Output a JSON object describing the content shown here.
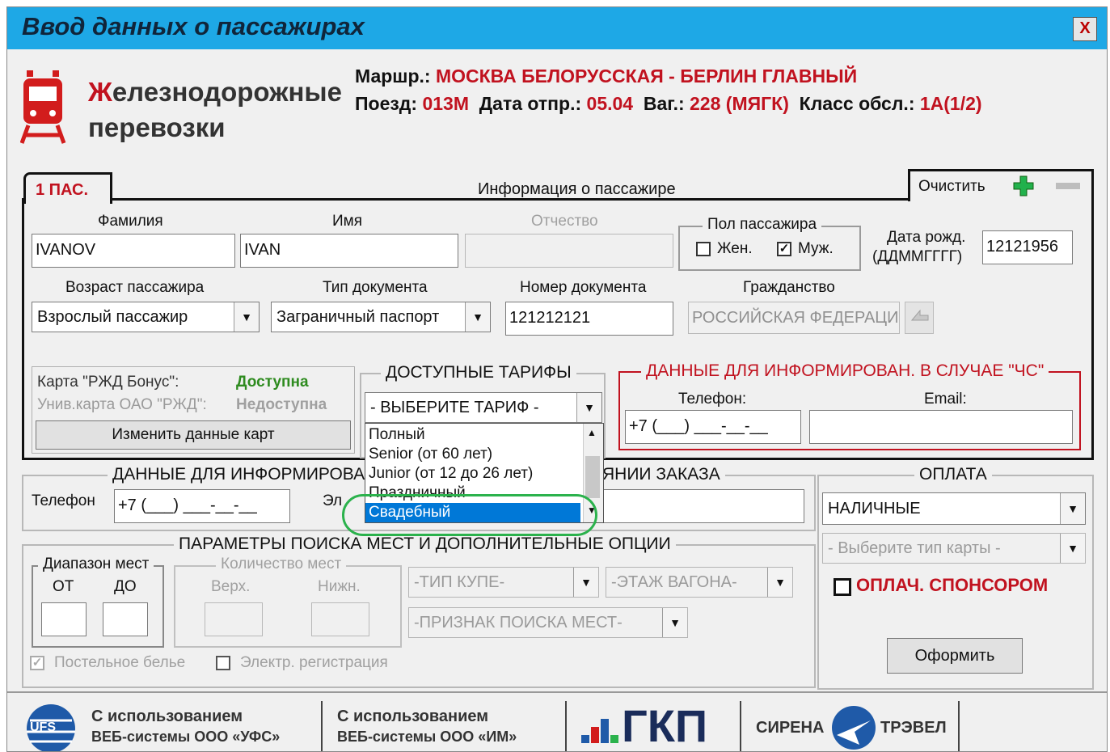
{
  "window": {
    "title": "Ввод данных о пассажирах",
    "close_glyph": "X"
  },
  "logo": {
    "line1_first": "Ж",
    "line1_rest": "елезнодорожные",
    "line2": "перевозки"
  },
  "route": {
    "label": "Маршр.:",
    "value": "МОСКВА БЕЛОРУССКАЯ - БЕРЛИН ГЛАВНЫЙ",
    "train_label": "Поезд:",
    "train_value": "013М",
    "date_label": "Дата отпр.:",
    "date_value": "05.04",
    "car_label": "Ваг.:",
    "car_value": "228 (МЯГК)",
    "class_label": "Класс обсл.:",
    "class_value": "1А(1/2)"
  },
  "passenger_panel": {
    "tab": "1 ПАС.",
    "header": "Информация о пассажире",
    "clear_button": "Очистить",
    "surname_label": "Фамилия",
    "surname_value": "IVANOV",
    "name_label": "Имя",
    "name_value": "IVAN",
    "patronymic_label": "Отчество",
    "patronymic_value": "",
    "gender_group": "Пол пассажира",
    "female_label": "Жен.",
    "male_label": "Муж.",
    "female_checked": false,
    "male_checked": true,
    "birth_label_1": "Дата рожд.",
    "birth_label_2": "(ДДММГГГГ)",
    "birth_value": "12121956",
    "age_label": "Возраст пассажира",
    "age_value": "Взрослый пассажир",
    "doc_type_label": "Тип документа",
    "doc_type_value": "Заграничный паспорт",
    "doc_number_label": "Номер документа",
    "doc_number_value": "121212121",
    "citizenship_label": "Гражданство",
    "citizenship_value": "РОССИЙСКАЯ ФЕДЕРАЦИ",
    "bonus_card_label": "Карта \"РЖД Бонус\":",
    "bonus_card_status": "Доступна",
    "univ_card_label": "Унив.карта ОАО \"РЖД\":",
    "univ_card_status": "Недоступна",
    "change_cards_button": "Изменить данные карт"
  },
  "tariffs": {
    "caption": "ДОСТУПНЫЕ ТАРИФЫ",
    "selected": "- ВЫБЕРИТЕ ТАРИФ -",
    "options": [
      "Полный",
      "Senior (от 60 лет)",
      "Junior (от 12 до 26 лет)",
      "Праздничный",
      "Свадебный"
    ],
    "highlighted_index": 4
  },
  "emergency": {
    "caption": "ДАННЫЕ ДЛЯ ИНФОРМИРОВАН. В СЛУЧАЕ \"ЧС\"",
    "phone_label": "Телефон:",
    "phone_value": "+7 (___) ___-__-__",
    "email_label": "Email:",
    "email_value": ""
  },
  "order_info": {
    "caption_left": "ДАННЫЕ ДЛЯ ИНФОРМИРОВА",
    "caption_right": "ЯНИИ ЗАКАЗА",
    "phone_label": "Телефон",
    "phone_value": "+7 (___) ___-__-__",
    "email_label_part": "Эл"
  },
  "payment": {
    "caption": "ОПЛАТА",
    "method": "НАЛИЧНЫЕ",
    "card_type": "- Выберите тип карты -",
    "sponsor_label": "ОПЛАЧ. СПОНСОРОМ",
    "submit_button": "Оформить"
  },
  "search": {
    "caption": "ПАРАМЕТРЫ ПОИСКА МЕСТ И ДОПОЛНИТЕЛЬНЫЕ ОПЦИИ",
    "range_caption": "Диапазон мест",
    "from_label": "ОТ",
    "to_label": "ДО",
    "count_caption": "Количество мест",
    "upper_label": "Верх.",
    "lower_label": "Нижн.",
    "compartment_type": "-ТИП КУПЕ-",
    "car_floor": "-ЭТАЖ ВАГОНА-",
    "seat_search": "-ПРИЗНАК ПОИСКА МЕСТ-",
    "bedding_label": "Постельное белье",
    "ereg_label": "Электр. регистрация",
    "bedding_checked": true,
    "ereg_checked": false
  },
  "footer": {
    "ufs_badge": "UFS",
    "ufs_line1": "С использованием",
    "ufs_line2": "ВЕБ-системы ООО «УФС»",
    "im_line1": "С использованием",
    "im_line2": "ВЕБ-системы ООО «ИМ»",
    "gkp_logo": "ГКП",
    "sirena_left": "СИРЕНА",
    "sirena_right": "ТРЭВЕЛ"
  },
  "colors": {
    "titlebar": "#1ea8e6",
    "accent_red": "#c1121f",
    "available_green": "#2e8b1f",
    "highlight_blue": "#0078d7",
    "annotation_green": "#2bb24c"
  }
}
